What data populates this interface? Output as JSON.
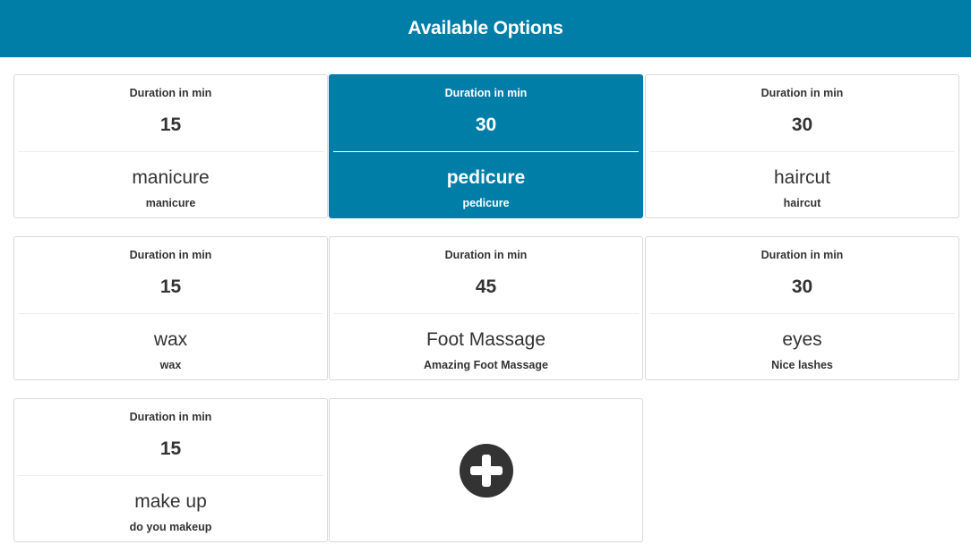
{
  "header": {
    "title": "Available Options"
  },
  "colors": {
    "accent": "#007ea8",
    "text": "#333333",
    "border": "#d9d9d9"
  },
  "options": [
    {
      "duration_label": "Duration in min",
      "duration": "15",
      "name": "manicure",
      "description": "manicure",
      "selected": false
    },
    {
      "duration_label": "Duration in min",
      "duration": "30",
      "name": "pedicure",
      "description": "pedicure",
      "selected": true
    },
    {
      "duration_label": "Duration in min",
      "duration": "30",
      "name": "haircut",
      "description": "haircut",
      "selected": false
    },
    {
      "duration_label": "Duration in min",
      "duration": "15",
      "name": "wax",
      "description": "wax",
      "selected": false
    },
    {
      "duration_label": "Duration in min",
      "duration": "45",
      "name": "Foot Massage",
      "description": "Amazing Foot Massage",
      "selected": false
    },
    {
      "duration_label": "Duration in min",
      "duration": "30",
      "name": "eyes",
      "description": "Nice lashes",
      "selected": false
    },
    {
      "duration_label": "Duration in min",
      "duration": "15",
      "name": "make up",
      "description": "do you makeup",
      "selected": false
    }
  ],
  "add_option": {
    "icon": "plus-circle-icon"
  }
}
